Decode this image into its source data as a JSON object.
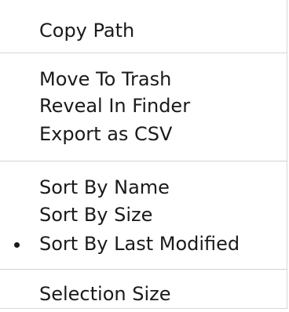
{
  "menu": {
    "items": [
      {
        "label": "Copy Path"
      },
      {
        "label": "Move To Trash"
      },
      {
        "label": "Reveal In Finder"
      },
      {
        "label": "Export as CSV"
      },
      {
        "label": "Sort By Name"
      },
      {
        "label": "Sort By Size"
      },
      {
        "label": "Sort By Last Modified",
        "checked": true
      },
      {
        "label": "Selection Size"
      }
    ],
    "checked_marker": "bullet"
  }
}
